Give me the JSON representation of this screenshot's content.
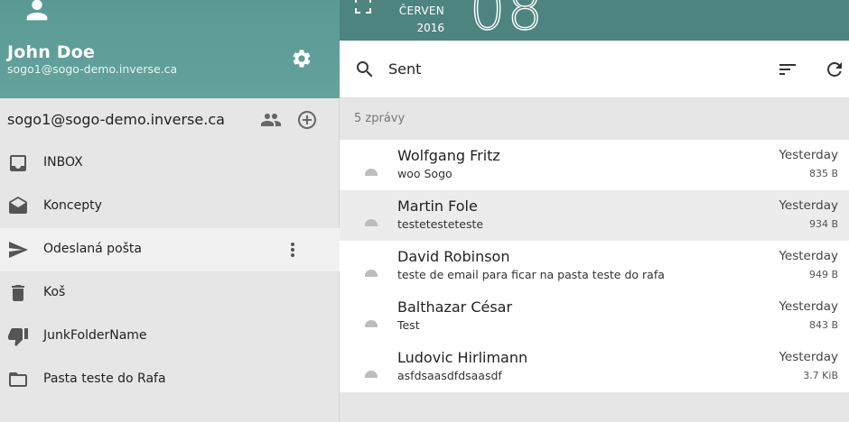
{
  "user": {
    "name": "John Doe",
    "email": "sogo1@sogo-demo.inverse.ca"
  },
  "account": {
    "name": "sogo1@sogo-demo.inverse.ca"
  },
  "folders": [
    {
      "label": "INBOX",
      "icon": "inbox-icon",
      "active": false
    },
    {
      "label": "Koncepty",
      "icon": "drafts-icon",
      "active": false
    },
    {
      "label": "Odeslaná pošta",
      "icon": "send-icon",
      "active": true
    },
    {
      "label": "Koš",
      "icon": "trash-icon",
      "active": false
    },
    {
      "label": "JunkFolderName",
      "icon": "thumb-down-icon",
      "active": false
    },
    {
      "label": "Pasta teste do Rafa",
      "icon": "folder-icon",
      "active": false
    }
  ],
  "calendar": {
    "month": "ČERVEN",
    "year": "2016",
    "day": "08"
  },
  "mailbox": {
    "title": "Sent",
    "count_label": "5 zprávy"
  },
  "messages": [
    {
      "sender": "Wolfgang Fritz",
      "subject": "woo Sogo",
      "date": "Yesterday",
      "size": "835 B"
    },
    {
      "sender": "Martin Fole",
      "subject": "testetesteteste",
      "date": "Yesterday",
      "size": "934 B"
    },
    {
      "sender": "David Robinson",
      "subject": "teste de email para ficar na pasta teste do rafa",
      "date": "Yesterday",
      "size": "949 B"
    },
    {
      "sender": "Balthazar César",
      "subject": "Test",
      "date": "Yesterday",
      "size": "843 B"
    },
    {
      "sender": "Ludovic Hirlimann",
      "subject": "asfdsaasdfdsaasdf",
      "date": "Yesterday",
      "size": "3.7 KiB"
    }
  ],
  "colors": {
    "header_teal": "#5f9e98",
    "topbar_teal": "#4e8480",
    "sidebar_bg": "#e6e6e6",
    "active_row": "#f1f1f1"
  }
}
